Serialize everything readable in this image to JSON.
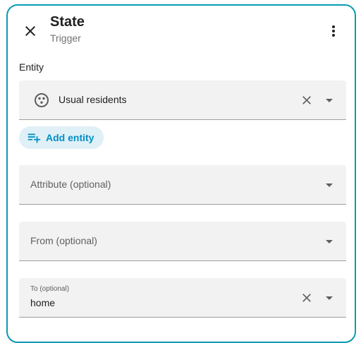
{
  "header": {
    "title": "State",
    "subtitle": "Trigger"
  },
  "entity_section": {
    "label": "Entity",
    "selected_entity": "Usual residents",
    "add_entity_label": "Add entity"
  },
  "fields": {
    "attribute_placeholder": "Attribute (optional)",
    "from_placeholder": "From (optional)",
    "to_label": "To (optional)",
    "to_value": "home"
  },
  "colors": {
    "accent": "#038fc7",
    "border": "#0a9bb4",
    "field_bg": "#f2f2f2",
    "chip_bg": "#dff0f6"
  },
  "icons": {
    "close": "close-icon",
    "more": "more-vert-icon",
    "entity": "group-icon",
    "clear": "clear-icon",
    "dropdown": "arrow-drop-down-icon",
    "add": "playlist-add-icon"
  }
}
